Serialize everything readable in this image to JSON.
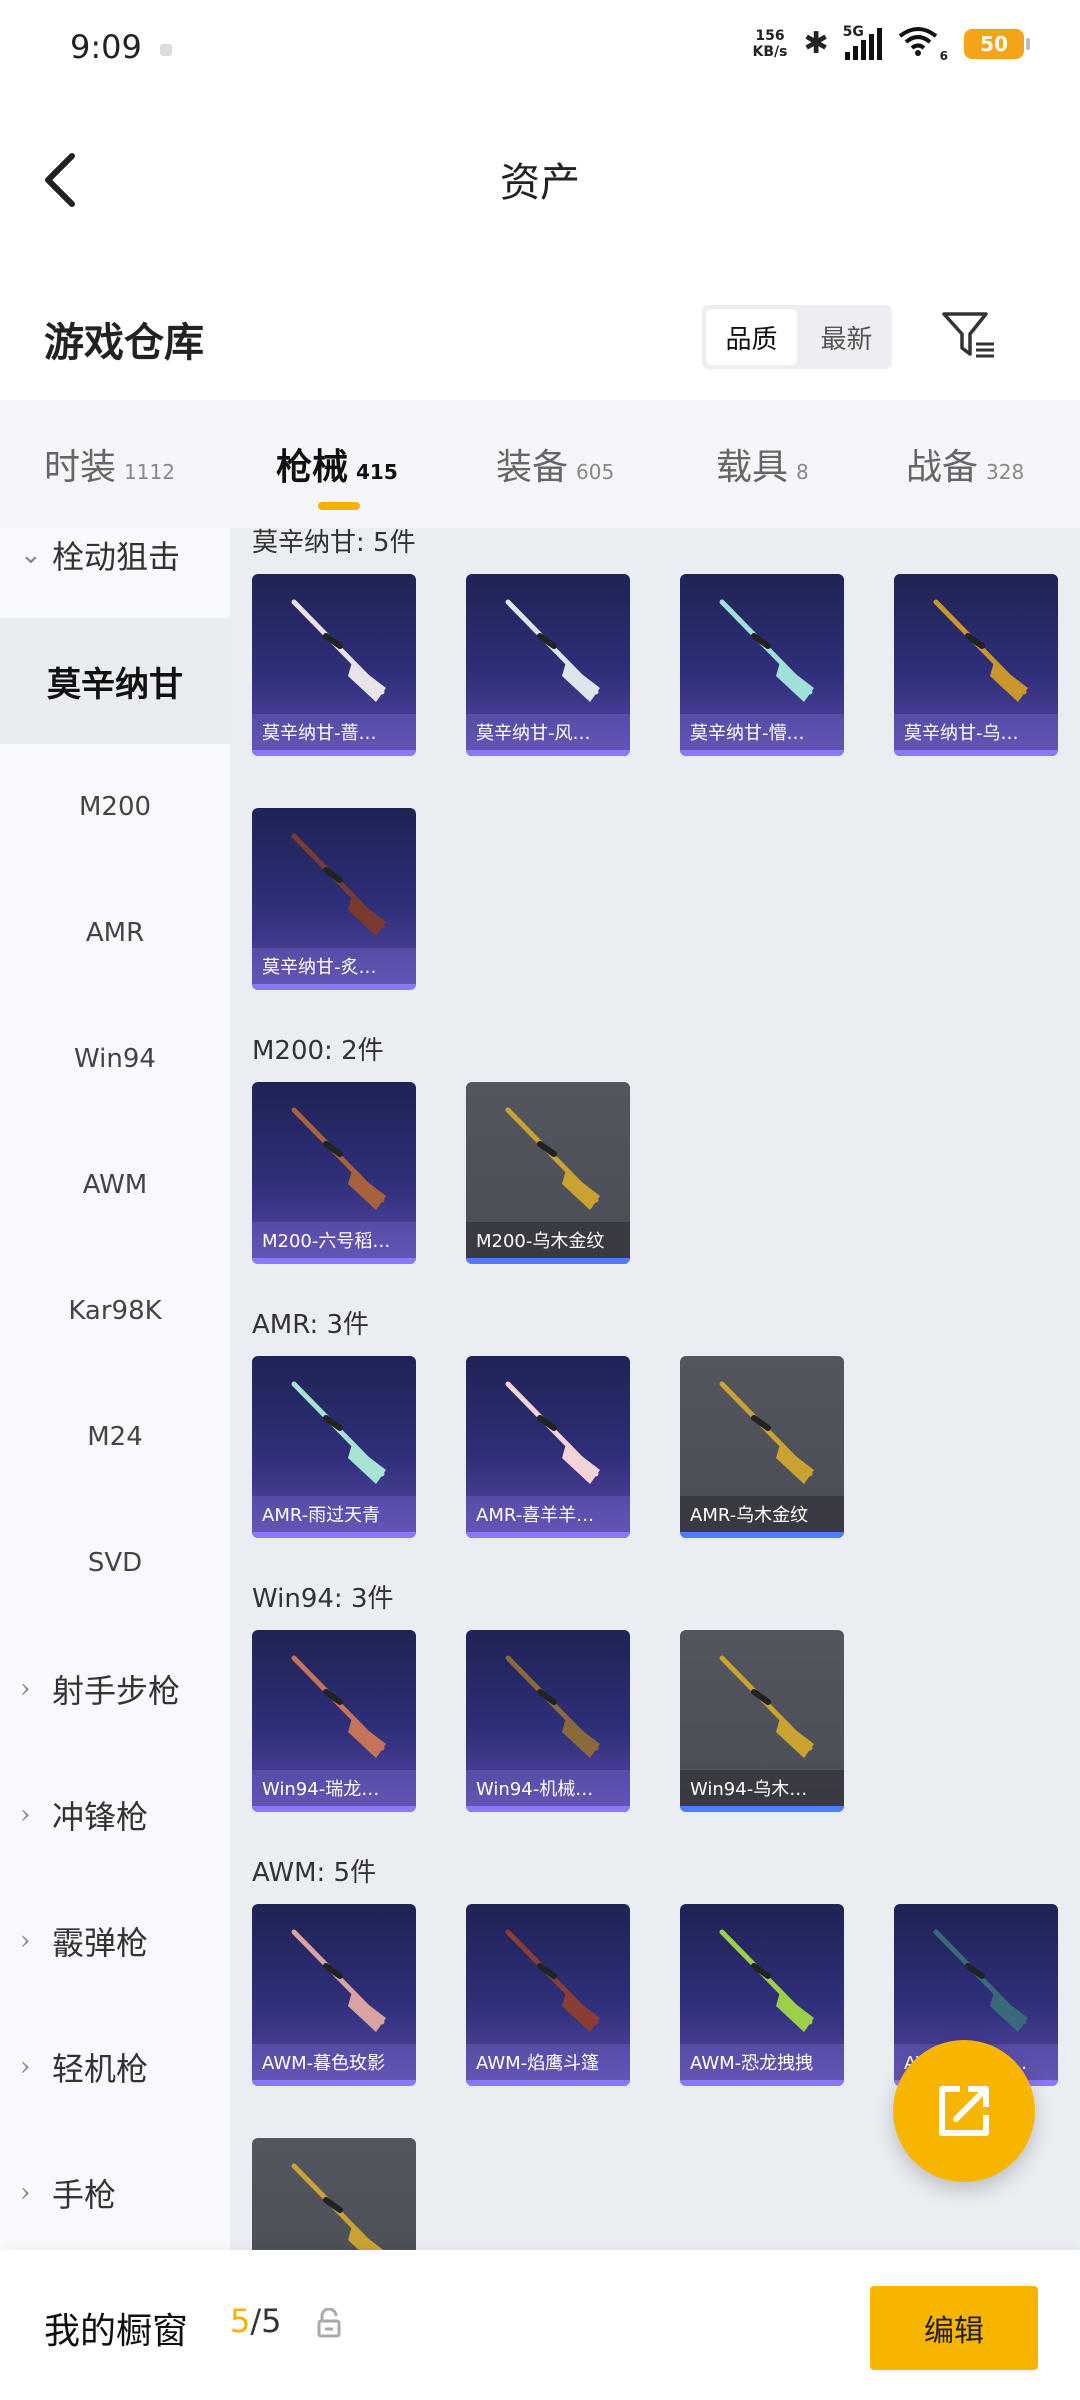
{
  "status_bar": {
    "time": "9:09",
    "net_speed_value": "156",
    "net_speed_unit": "KB/s",
    "signal_label": "5G",
    "wifi_sub": "6",
    "battery": "50",
    "battery_color": "#f5a41a"
  },
  "header": {
    "title": "资产",
    "back_icon": "chevron-left-icon"
  },
  "warehouse": {
    "title": "游戏仓库",
    "sort_options": [
      "品质",
      "最新"
    ],
    "sort_selected": "品质",
    "filter_icon": "filter-icon"
  },
  "tabs": [
    {
      "label": "时装",
      "count": "1112"
    },
    {
      "label": "枪械",
      "count": "415",
      "active": true
    },
    {
      "label": "装备",
      "count": "605"
    },
    {
      "label": "载具",
      "count": "8"
    },
    {
      "label": "战备",
      "count": "328"
    }
  ],
  "sidebar": {
    "items": [
      {
        "label": "栓动狙击",
        "type": "group",
        "chevron": "chevron-down"
      },
      {
        "label": "莫辛纳甘",
        "type": "item",
        "active": true
      },
      {
        "label": "M200",
        "type": "item"
      },
      {
        "label": "AMR",
        "type": "item"
      },
      {
        "label": "Win94",
        "type": "item"
      },
      {
        "label": "AWM",
        "type": "item"
      },
      {
        "label": "Kar98K",
        "type": "item"
      },
      {
        "label": "M24",
        "type": "item"
      },
      {
        "label": "SVD",
        "type": "item"
      },
      {
        "label": "射手步枪",
        "type": "group",
        "chevron": "chevron-right"
      },
      {
        "label": "冲锋枪",
        "type": "group",
        "chevron": "chevron-right"
      },
      {
        "label": "霰弹枪",
        "type": "group",
        "chevron": "chevron-right"
      },
      {
        "label": "轻机枪",
        "type": "group",
        "chevron": "chevron-right"
      },
      {
        "label": "手枪",
        "type": "group",
        "chevron": "chevron-right"
      }
    ]
  },
  "sections": [
    {
      "title": "莫辛纳甘: 5件",
      "cards": [
        {
          "label": "莫辛纳甘-蔷…",
          "rarity": "purple",
          "gun_color": "#e9e2e6"
        },
        {
          "label": "莫辛纳甘-风…",
          "rarity": "purple",
          "gun_color": "#dde6ee"
        },
        {
          "label": "莫辛纳甘-懵…",
          "rarity": "purple",
          "gun_color": "#9fe0da"
        },
        {
          "label": "莫辛纳甘-乌…",
          "rarity": "purple",
          "gun_color": "#c9972e"
        },
        {
          "label": "莫辛纳甘-炙…",
          "rarity": "purple",
          "gun_color": "#7a3b2e"
        }
      ]
    },
    {
      "title": "M200: 2件",
      "cards": [
        {
          "label": "M200-六号稻…",
          "rarity": "purple",
          "gun_color": "#a8623a"
        },
        {
          "label": "M200-乌木金纹",
          "rarity": "gray",
          "gun_color": "#c9a232"
        }
      ]
    },
    {
      "title": "AMR: 3件",
      "cards": [
        {
          "label": "AMR-雨过天青",
          "rarity": "purple",
          "gun_color": "#a6e3d2"
        },
        {
          "label": "AMR-喜羊羊…",
          "rarity": "purple",
          "gun_color": "#f1d3d8"
        },
        {
          "label": "AMR-乌木金纹",
          "rarity": "gray",
          "gun_color": "#c9a232"
        }
      ]
    },
    {
      "title": "Win94: 3件",
      "cards": [
        {
          "label": "Win94-瑞龙…",
          "rarity": "purple",
          "gun_color": "#c7735a"
        },
        {
          "label": "Win94-机械…",
          "rarity": "purple",
          "gun_color": "#8a6a3a"
        },
        {
          "label": "Win94-乌木…",
          "rarity": "gray",
          "gun_color": "#c9a232"
        }
      ]
    },
    {
      "title": "AWM: 5件",
      "cards": [
        {
          "label": "AWM-暮色玫影",
          "rarity": "purple",
          "gun_color": "#d8a3a0"
        },
        {
          "label": "AWM-焰鹰斗篷",
          "rarity": "purple",
          "gun_color": "#8a3d33"
        },
        {
          "label": "AWM-恐龙拽拽",
          "rarity": "purple",
          "gun_color": "#9ccf4a"
        },
        {
          "label": "AWM-无夜海…",
          "rarity": "purple",
          "gun_color": "#3a6a7a"
        },
        {
          "label": "",
          "rarity": "gray",
          "gun_color": "#c9a232"
        }
      ]
    }
  ],
  "fab": {
    "icon": "share-export-icon",
    "color": "#f8b500"
  },
  "bottom": {
    "title": "我的橱窗",
    "current": "5",
    "total": "/5",
    "lock_icon": "lock-icon",
    "edit_label": "编辑",
    "accent": "#f8b500"
  }
}
